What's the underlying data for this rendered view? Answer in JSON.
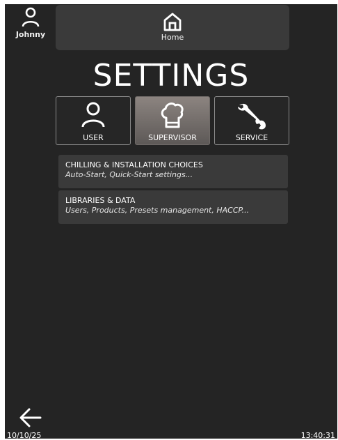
{
  "user": {
    "name": "Johnny",
    "icon": "user-icon"
  },
  "header": {
    "home_label": "Home",
    "home_icon": "home-icon"
  },
  "page": {
    "title": "SETTINGS"
  },
  "tabs": [
    {
      "label": "USER",
      "icon": "user-icon",
      "active": false
    },
    {
      "label": "SUPERVISOR",
      "icon": "chef-hat-icon",
      "active": true
    },
    {
      "label": "SERVICE",
      "icon": "wrench-icon",
      "active": false
    }
  ],
  "menu": [
    {
      "title": "CHILLING & INSTALLATION CHOICES",
      "subtitle": "Auto-Start, Quick-Start settings..."
    },
    {
      "title": "LIBRARIES & DATA",
      "subtitle": "Users, Products, Presets management, HACCP..."
    }
  ],
  "footer": {
    "date": "10/10/25",
    "time": "13:40:31",
    "back_icon": "back-arrow-icon"
  },
  "colors": {
    "background": "#242424",
    "panel": "#3a3a3a",
    "active_tab": "#7a7370",
    "text": "#ffffff"
  }
}
